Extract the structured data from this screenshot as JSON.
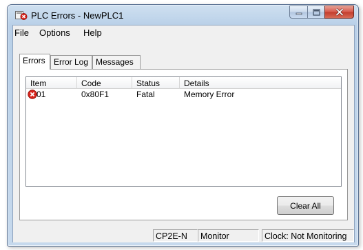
{
  "window": {
    "title": "PLC Errors - NewPLC1"
  },
  "menu": [
    {
      "label": "File"
    },
    {
      "label": "Options"
    },
    {
      "label": "Help"
    }
  ],
  "tabs": [
    {
      "label": "Errors",
      "active": true
    },
    {
      "label": "Error Log",
      "active": false
    },
    {
      "label": "Messages",
      "active": false
    }
  ],
  "errors_table": {
    "columns": [
      "Item",
      "Code",
      "Status",
      "Details"
    ],
    "rows": [
      {
        "icon": "error-x-icon",
        "item": "01",
        "code": "0x80F1",
        "status": "Fatal",
        "details": "Memory Error"
      }
    ]
  },
  "buttons": {
    "clear_all": "Clear All"
  },
  "status_bar": {
    "model": "CP2E-N",
    "mode": "Monitor",
    "clock": "Clock: Not Monitoring"
  },
  "colors": {
    "error_icon": "#d8241c",
    "close_button": "#c9463a"
  }
}
